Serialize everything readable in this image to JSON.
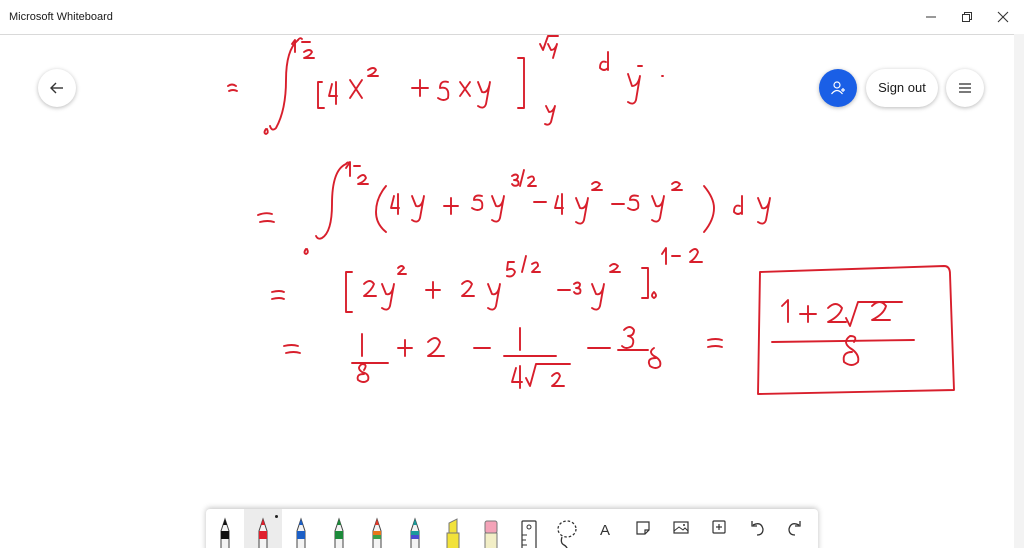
{
  "window": {
    "title": "Microsoft Whiteboard",
    "controls": [
      "minimize-icon",
      "restore-icon",
      "close-icon"
    ]
  },
  "header": {
    "back_icon": "arrow-left-icon",
    "invite_icon": "add-person-icon",
    "sign_out_label": "Sign out",
    "menu_icon": "hamburger-menu-icon"
  },
  "colors": {
    "ink": "#d81f2c",
    "accent": "#1a5fe6"
  },
  "toolbar": {
    "tools": [
      {
        "name": "black-pen",
        "icon": "pen-icon",
        "color": "#111111"
      },
      {
        "name": "red-pen",
        "icon": "pen-icon",
        "color": "#e0202d",
        "active": true
      },
      {
        "name": "blue-pen",
        "icon": "pen-icon",
        "color": "#1c5fc6"
      },
      {
        "name": "green-pen",
        "icon": "pen-icon",
        "color": "#1c8a3a"
      },
      {
        "name": "rainbow-pen",
        "icon": "pen-icon",
        "color": "#e8761a"
      },
      {
        "name": "galaxy-pen",
        "icon": "pen-icon",
        "color": "#1b9a9a"
      },
      {
        "name": "yellow-highlighter",
        "icon": "highlighter-icon",
        "color": "#f2e23a"
      },
      {
        "name": "eraser",
        "icon": "eraser-icon",
        "color": "#f4a3b8"
      },
      {
        "name": "ruler",
        "icon": "ruler-icon",
        "color": "#333333"
      },
      {
        "name": "lasso-select",
        "icon": "lasso-icon",
        "color": "#333333"
      },
      {
        "name": "text",
        "icon": "text-icon",
        "label": "A"
      },
      {
        "name": "sticky-note",
        "icon": "note-icon"
      },
      {
        "name": "image",
        "icon": "image-icon"
      },
      {
        "name": "add",
        "icon": "plus-box-icon"
      },
      {
        "name": "undo",
        "icon": "undo-icon"
      },
      {
        "name": "redo",
        "icon": "redo-icon"
      }
    ]
  }
}
